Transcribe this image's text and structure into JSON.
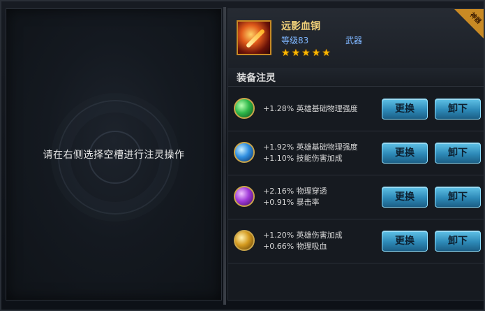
{
  "left_panel": {
    "hint": "请在右侧选择空槽进行注灵操作"
  },
  "item": {
    "name": "远影血铜",
    "level": "等级83",
    "type": "武器",
    "stars": 5,
    "badge": "神器",
    "icon": "weapon-icon"
  },
  "section": {
    "title": "装备注灵"
  },
  "slots": [
    {
      "gem": "green-gem-icon",
      "lines": [
        "+1.28% 英雄基础物理强度"
      ],
      "replace_label": "更换",
      "remove_label": "卸下"
    },
    {
      "gem": "blue-gem-icon",
      "lines": [
        "+1.92% 英雄基础物理强度",
        "+1.10% 技能伤害加成"
      ],
      "replace_label": "更换",
      "remove_label": "卸下"
    },
    {
      "gem": "purple-gem-icon",
      "lines": [
        "+2.16% 物理穿透",
        "+0.91% 暴击率"
      ],
      "replace_label": "更换",
      "remove_label": "卸下"
    },
    {
      "gem": "gold-gem-icon",
      "lines": [
        "+1.20% 英雄伤害加成",
        "+0.66% 物理吸血"
      ],
      "replace_label": "更换",
      "remove_label": "卸下"
    }
  ],
  "colors": {
    "button_blue": "#2d89b7",
    "gold_accent": "#c98a24",
    "level_blue": "#7fb6ff",
    "name_gold": "#f2d27a"
  }
}
